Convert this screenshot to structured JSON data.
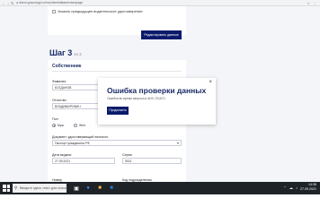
{
  "browser": {
    "nav_icons": "← → ↻",
    "url": "● direct.gosuslugi.ru/mo/client/dataservice/page",
    "right_icons": "☆ ⋮"
  },
  "top_section": {
    "checkbox_label": "Указать предыдущее водительское удостоверение",
    "edit_button": "Редактировать данные"
  },
  "step": {
    "title": "Шаг 3",
    "of": "из 3"
  },
  "card": {
    "title": "Собственник",
    "surname_label": "Фамилия",
    "surname_value": "БОГДАНОВ",
    "patronymic_label": "Отчество",
    "patronymic_value": "ВЛАДИМИРОВИЧ",
    "gender_label": "Пол",
    "gender_male": "Муж.",
    "gender_female": "Жен.",
    "doc_label": "Документ, удостоверяющий личность",
    "doc_value": "Паспорт гражданина РФ",
    "issue_date_label": "Дата выдачи",
    "issue_date_value": "27.09.2021",
    "series_label": "Серия",
    "series_value": "5021",
    "number_label": "Номер",
    "code_label": "Код подразделения"
  },
  "modal": {
    "close": "×",
    "title": "Ошибка проверки данных",
    "text": "Ошибка во время запроса в АИС ОСАГО",
    "button": "Продолжить"
  },
  "taskbar": {
    "search_placeholder": "Введите здесь текст для поиска",
    "time": "14:35",
    "date": "27.09.2021",
    "tray_icons": "⌃ ☁ ♪"
  },
  "colors": {
    "accent": "#0b1a6b",
    "heading": "#1a2b66",
    "taskbar": "#1e2328"
  }
}
